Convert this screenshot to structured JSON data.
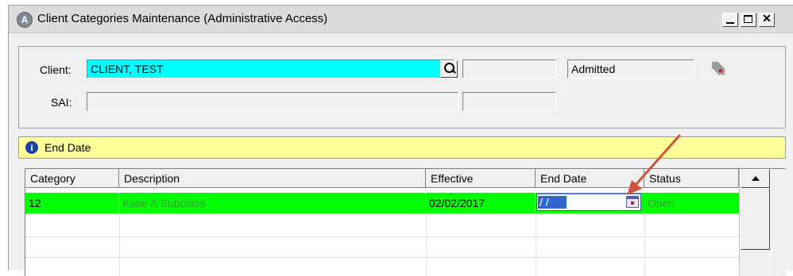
{
  "window": {
    "app_icon_letter": "A",
    "title": "Client Categories Maintenance (Administrative Access)"
  },
  "client_panel": {
    "client_label": "Client:",
    "client_value": "CLIENT, TEST",
    "client_id_value": "",
    "status_value": "Admitted",
    "sai_label": "SAI:",
    "sai_value": "",
    "sai_extra_value": ""
  },
  "info_bar": {
    "icon": "info-icon",
    "text": "End Date"
  },
  "grid": {
    "columns": [
      "Category",
      "Description",
      "Effective",
      "End Date",
      "Status"
    ],
    "rows": [
      {
        "category": "12",
        "description": "Katie A Subclass",
        "effective": "02/02/2017",
        "end_date": "/ /",
        "status": "Open"
      }
    ]
  },
  "colors": {
    "client_field": "#00ffff",
    "row_highlight": "#00ff00",
    "info_bar": "#ffff99",
    "arrow": "#d0533a"
  }
}
